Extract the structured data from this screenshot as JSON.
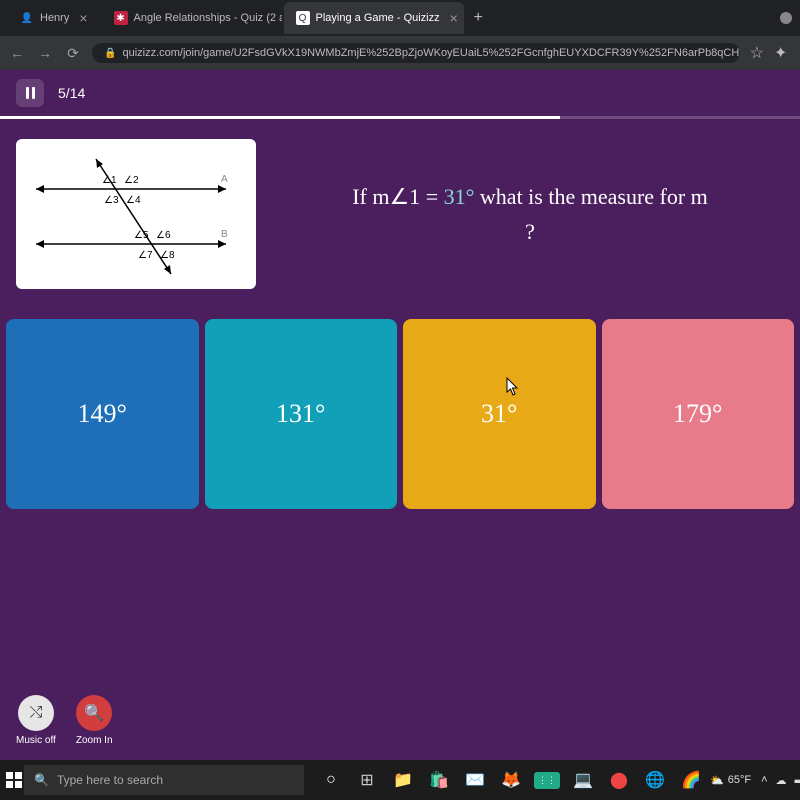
{
  "browser": {
    "tabs": [
      {
        "title": "Henry",
        "active": false
      },
      {
        "title": "Angle Relationships - Quiz (2 at",
        "active": false
      },
      {
        "title": "Playing a Game - Quizizz",
        "active": true
      }
    ],
    "url": "quizizz.com/join/game/U2FsdGVkX19NWMbZmjE%252BpZjoWKoyEUaiL5%252FGcnfghEUYXDCFR39Y%252FN6arPb8qCH7MMA7s65yXZ1F%252FAiyX..."
  },
  "quiz": {
    "progress_current": "5",
    "progress_total": "14",
    "question_prefix": "If m",
    "question_angle": "∠1",
    "question_eq": " = ",
    "question_value": "31°",
    "question_suffix": " what is the measure for m",
    "question_mark": "?",
    "diagram": {
      "labels": {
        "a1": "∠1",
        "a2": "∠2",
        "a3": "∠3",
        "a4": "∠4",
        "a5": "∠5",
        "a6": "∠6",
        "a7": "∠7",
        "a8": "∠8",
        "A": "A",
        "B": "B"
      }
    },
    "options": [
      {
        "label": "149°",
        "color": "blue"
      },
      {
        "label": "131°",
        "color": "teal"
      },
      {
        "label": "31°",
        "color": "gold"
      },
      {
        "label": "179°",
        "color": "pink"
      }
    ],
    "bottom": {
      "music": "Music off",
      "zoom": "Zoom In"
    }
  },
  "taskbar": {
    "search_placeholder": "Type here to search",
    "weather": "65°F"
  }
}
